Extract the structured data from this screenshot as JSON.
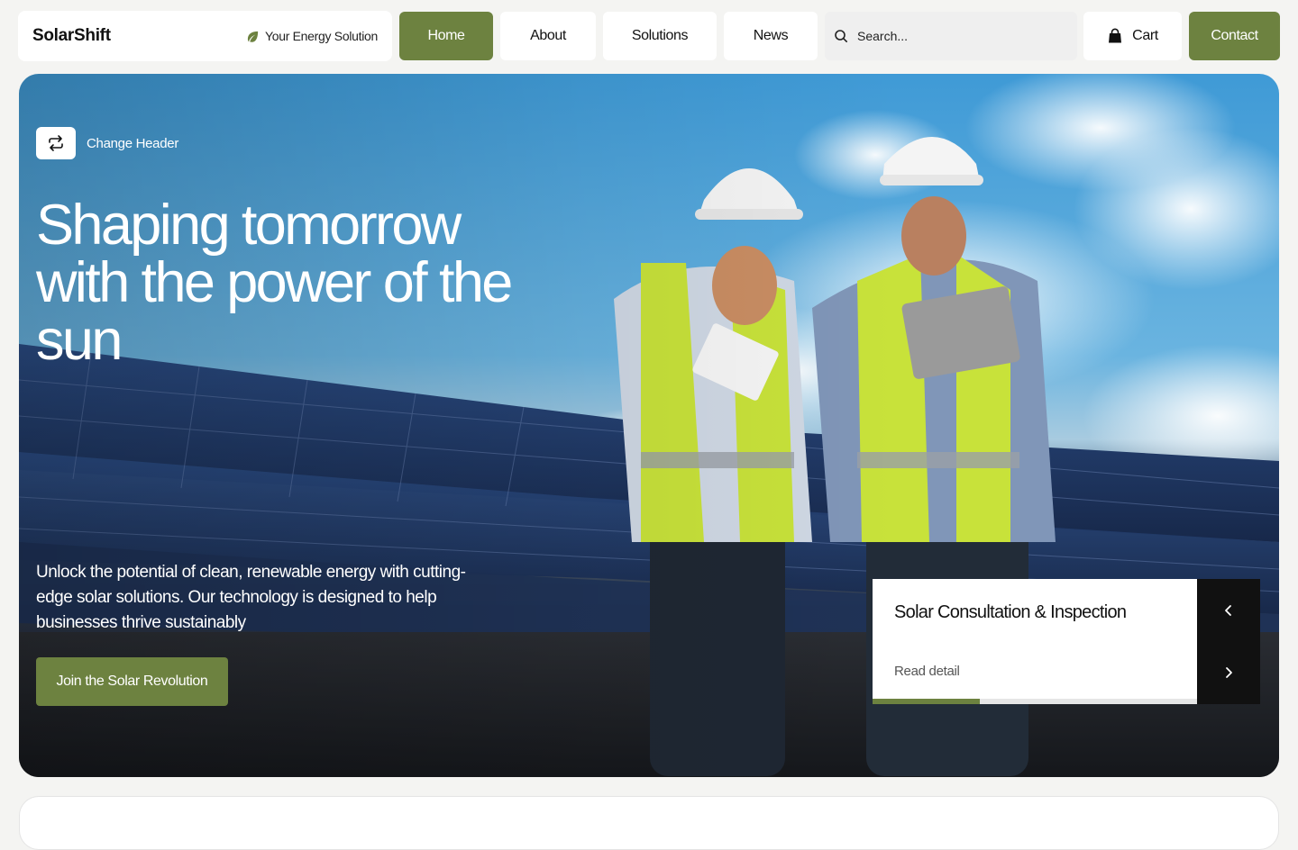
{
  "nav": {
    "brand": "SolarShift",
    "tagline": "Your Energy Solution",
    "items": [
      {
        "label": "Home",
        "active": true
      },
      {
        "label": "About",
        "active": false
      },
      {
        "label": "Solutions",
        "active": false
      },
      {
        "label": "News",
        "active": false
      }
    ],
    "search_placeholder": "Search...",
    "cart_label": "Cart",
    "contact_label": "Contact"
  },
  "hero": {
    "change_header_label": "Change Header",
    "title": "Shaping tomorrow with the power of the sun",
    "description": "Unlock the potential of clean, renewable energy with cutting-edge solar solutions. Our technology is designed to help businesses thrive sustainably",
    "cta_label": "Join the Solar Revolution",
    "slide": {
      "title": "Solar Consultation & Inspection",
      "link_label": "Read detail",
      "progress": 0.33
    }
  },
  "colors": {
    "accent": "#6d8240",
    "dark": "#111111"
  },
  "icons": {
    "tagline": "leaf-icon",
    "search": "search-icon",
    "cart": "shopping-bag-icon",
    "change_header": "repeat-icon",
    "prev": "chevron-left-icon",
    "next": "chevron-right-icon"
  }
}
